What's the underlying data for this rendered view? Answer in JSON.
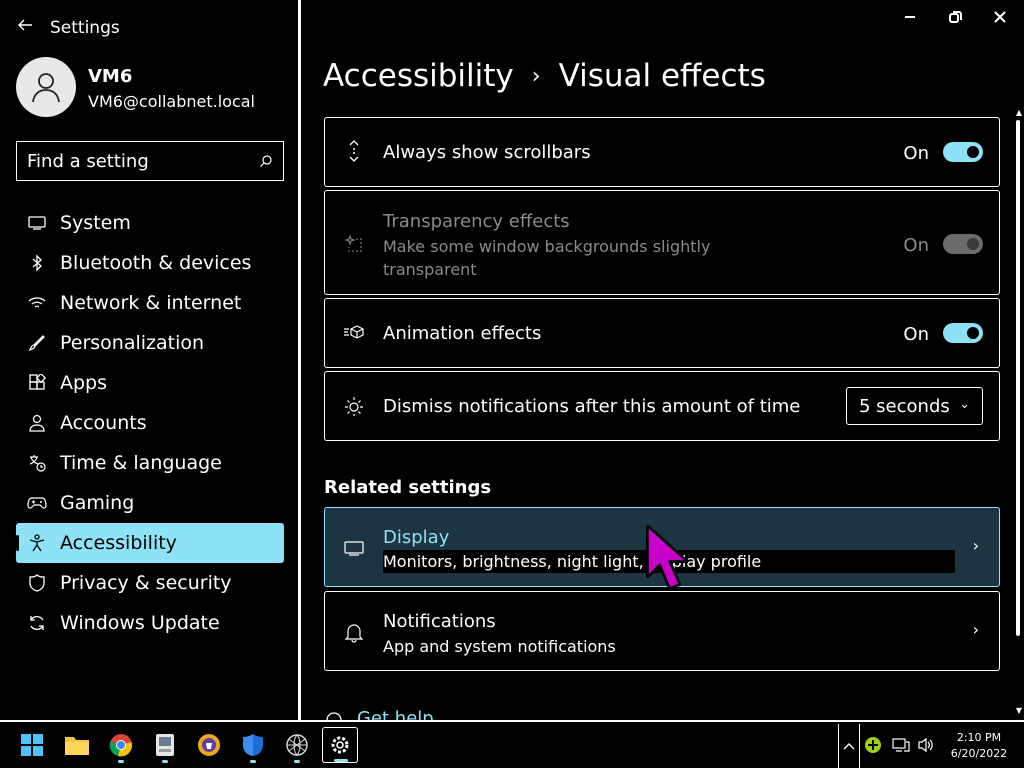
{
  "app": {
    "title": "Settings"
  },
  "user": {
    "name": "VM6",
    "email": "VM6@collabnet.local"
  },
  "search": {
    "placeholder": "Find a setting"
  },
  "sidebar": {
    "items": [
      {
        "label": "System",
        "icon": "monitor-icon"
      },
      {
        "label": "Bluetooth & devices",
        "icon": "bluetooth-icon"
      },
      {
        "label": "Network & internet",
        "icon": "wifi-icon"
      },
      {
        "label": "Personalization",
        "icon": "brush-icon"
      },
      {
        "label": "Apps",
        "icon": "apps-icon"
      },
      {
        "label": "Accounts",
        "icon": "person-icon"
      },
      {
        "label": "Time & language",
        "icon": "globe-clock-icon"
      },
      {
        "label": "Gaming",
        "icon": "gamepad-icon"
      },
      {
        "label": "Accessibility",
        "icon": "accessibility-icon",
        "active": true
      },
      {
        "label": "Privacy & security",
        "icon": "shield-icon"
      },
      {
        "label": "Windows Update",
        "icon": "update-icon"
      }
    ]
  },
  "breadcrumb": {
    "parent": "Accessibility",
    "current": "Visual effects"
  },
  "settings": {
    "scrollbars": {
      "title": "Always show scrollbars",
      "state": "On",
      "on": true
    },
    "transparency": {
      "title": "Transparency effects",
      "subtitle": "Make some window backgrounds slightly transparent",
      "state": "On",
      "disabled": true
    },
    "animation": {
      "title": "Animation effects",
      "state": "On",
      "on": true
    },
    "dismiss": {
      "title": "Dismiss notifications after this amount of time",
      "value": "5 seconds"
    }
  },
  "related": {
    "heading": "Related settings",
    "display": {
      "title": "Display",
      "subtitle": "Monitors, brightness, night light, display profile"
    },
    "notifications": {
      "title": "Notifications",
      "subtitle": "App and system notifications"
    },
    "get_help": "Get help"
  },
  "taskbar": {
    "apps": [
      "start-icon",
      "file-explorer-icon",
      "chrome-icon",
      "app-icon",
      "brave-icon",
      "defender-icon",
      "network-app-icon",
      "settings-icon"
    ],
    "time": "2:10 PM",
    "date": "6/20/2022"
  },
  "colors": {
    "accent": "#8ee2f6",
    "background": "#000000",
    "selected_card": "#1d3442",
    "cursor": "#c800c8"
  }
}
